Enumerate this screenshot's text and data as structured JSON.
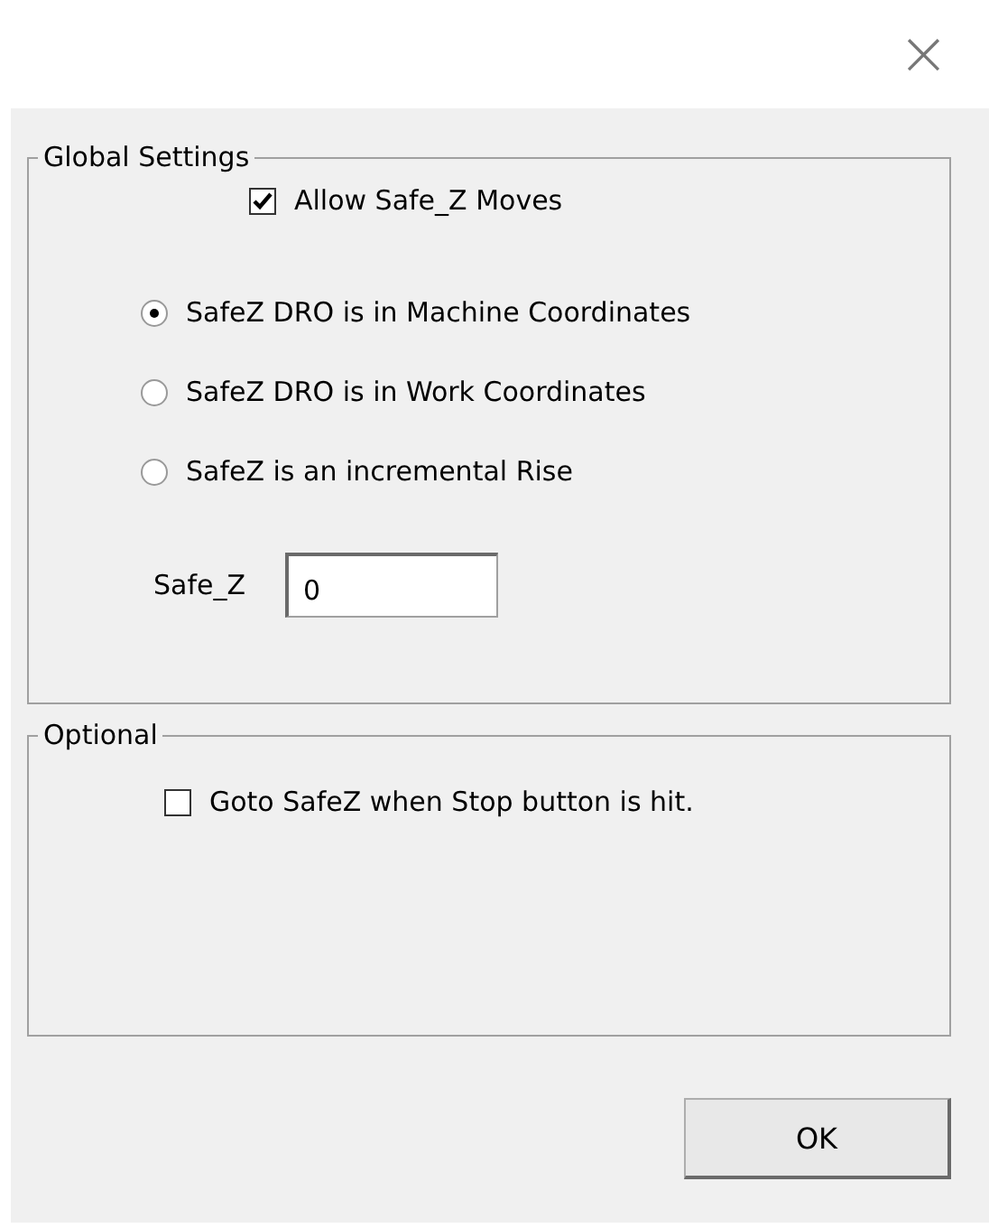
{
  "window": {
    "close": "×"
  },
  "global_settings": {
    "title": "Global Settings",
    "allow_safe_z": {
      "label": "Allow Safe_Z Moves",
      "checked": true
    },
    "modes": [
      {
        "label": "SafeZ DRO is in Machine Coordinates",
        "selected": true
      },
      {
        "label": "SafeZ DRO is in Work Coordinates",
        "selected": false
      },
      {
        "label": "SafeZ is an incremental Rise",
        "selected": false
      }
    ],
    "safe_z": {
      "label": "Safe_Z",
      "value": "0"
    }
  },
  "optional": {
    "title": "Optional",
    "goto_safez": {
      "label": "Goto SafeZ when Stop button is hit.",
      "checked": false
    }
  },
  "buttons": [
    "OK"
  ]
}
